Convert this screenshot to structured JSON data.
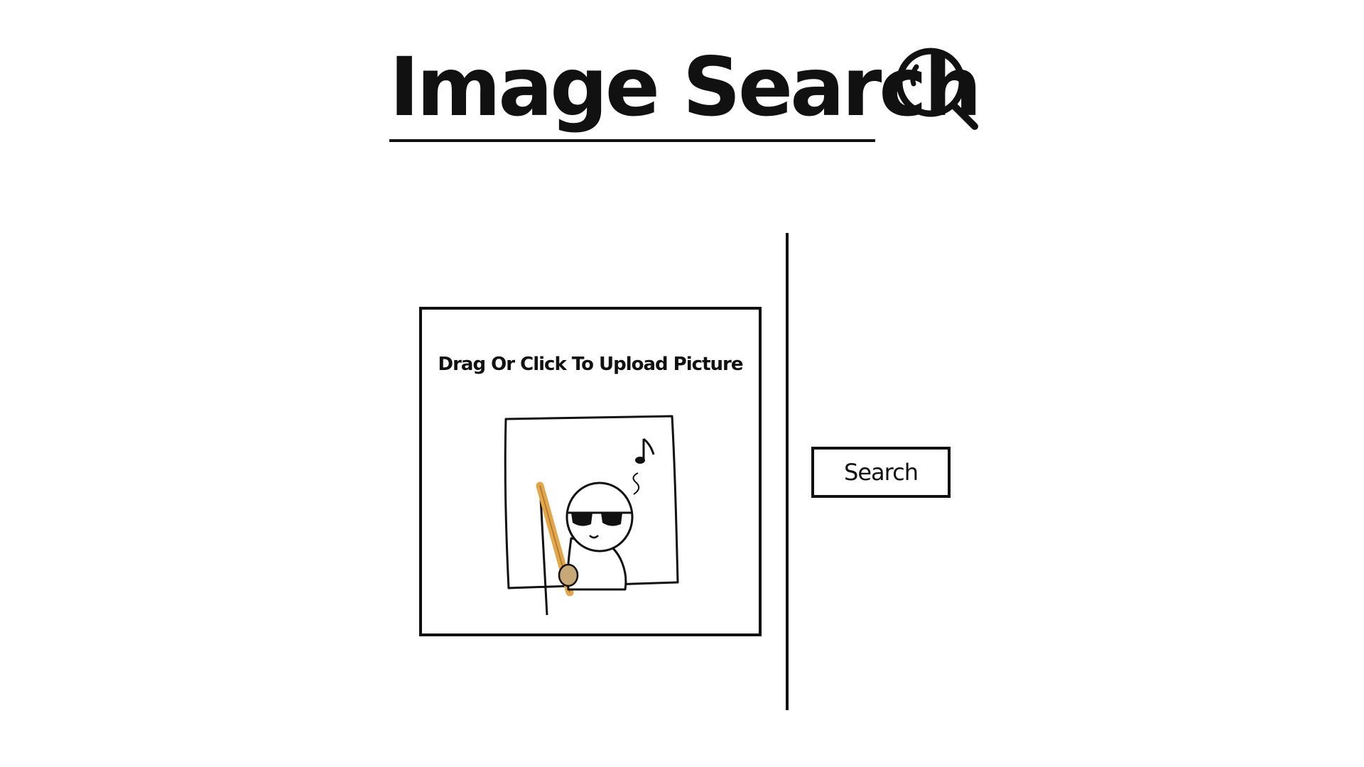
{
  "header": {
    "title": "Image Search",
    "icon": "search-icon"
  },
  "upload": {
    "label": "Drag Or Click To Upload Picture",
    "preview_icon": "cartoon-upload-illustration"
  },
  "actions": {
    "search_label": "Search"
  },
  "colors": {
    "text": "#111111",
    "background": "#ffffff",
    "stick": "#E3A64A"
  }
}
